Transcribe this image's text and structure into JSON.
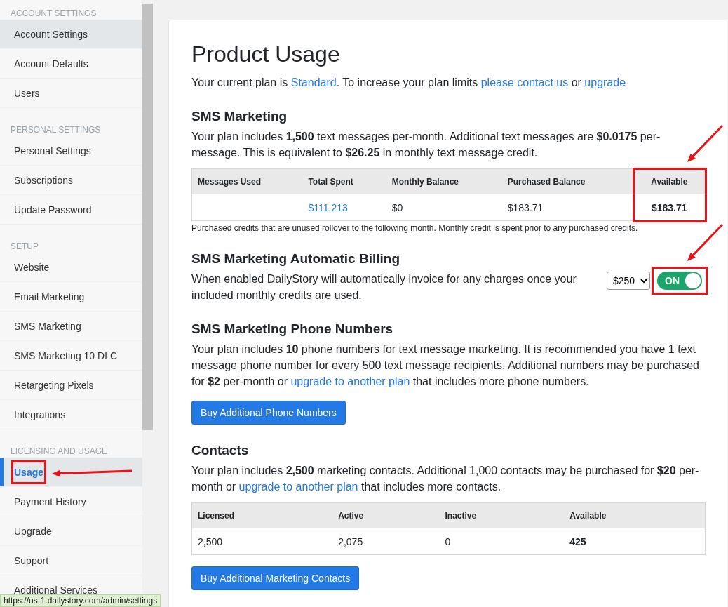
{
  "sidebar": {
    "sections": [
      {
        "heading": "ACCOUNT SETTINGS",
        "items": [
          {
            "label": "Account Settings",
            "selected": false,
            "hovered": true
          },
          {
            "label": "Account Defaults",
            "selected": false,
            "hovered": false
          },
          {
            "label": "Users",
            "selected": false,
            "hovered": false
          }
        ]
      },
      {
        "heading": "PERSONAL SETTINGS",
        "items": [
          {
            "label": "Personal Settings",
            "selected": false,
            "hovered": false
          },
          {
            "label": "Subscriptions",
            "selected": false,
            "hovered": false
          },
          {
            "label": "Update Password",
            "selected": false,
            "hovered": false
          }
        ]
      },
      {
        "heading": "SETUP",
        "items": [
          {
            "label": "Website",
            "selected": false,
            "hovered": false
          },
          {
            "label": "Email Marketing",
            "selected": false,
            "hovered": false
          },
          {
            "label": "SMS Marketing",
            "selected": false,
            "hovered": false
          },
          {
            "label": "SMS Marketing 10 DLC",
            "selected": false,
            "hovered": false
          },
          {
            "label": "Retargeting Pixels",
            "selected": false,
            "hovered": false
          },
          {
            "label": "Integrations",
            "selected": false,
            "hovered": false
          }
        ]
      },
      {
        "heading": "LICENSING AND USAGE",
        "items": [
          {
            "label": "Usage",
            "selected": true,
            "hovered": false,
            "annotated": true
          },
          {
            "label": "Payment History",
            "selected": false,
            "hovered": false
          },
          {
            "label": "Upgrade",
            "selected": false,
            "hovered": false
          },
          {
            "label": "Support",
            "selected": false,
            "hovered": false
          },
          {
            "label": "Additional Services",
            "selected": false,
            "hovered": false
          }
        ]
      }
    ]
  },
  "page": {
    "title": "Product Usage",
    "intro": [
      {
        "text": "Your current plan is "
      },
      {
        "link": "Standard"
      },
      {
        "text": ". To increase your plan limits "
      },
      {
        "link": "please contact us"
      },
      {
        "text": " or "
      },
      {
        "link": "upgrade"
      }
    ],
    "sections": [
      {
        "kind": "table",
        "heading": "SMS Marketing",
        "text": [
          {
            "text": "Your plan includes **1,500** text messages per-month. Additional text messages are **$0.0175** per-message. This is equivalent to **$26.25** in monthly text message credit."
          }
        ],
        "table": {
          "columns": [
            {
              "label": "Messages Used"
            },
            {
              "label": "Total Spent"
            },
            {
              "label": "Monthly Balance"
            },
            {
              "label": "Purchased Balance"
            },
            {
              "label": "Available",
              "annotated": true
            }
          ],
          "rows": [
            [
              {
                "text": ""
              },
              {
                "text": "$111.213",
                "link": true
              },
              {
                "text": "$0"
              },
              {
                "text": "$183.71"
              },
              {
                "text": "$183.71",
                "bold": true
              }
            ]
          ]
        },
        "note": "Purchased credits that are unused rollover to the following month. Monthly credit is spent prior to any purchased credits."
      },
      {
        "kind": "billing",
        "heading": "SMS Marketing Automatic Billing",
        "text": [
          {
            "text": "When enabled DailyStory will automatically invoice for any charges once your included monthly credits are used."
          }
        ],
        "amount": "$250",
        "toggle": {
          "label": "ON",
          "on": true,
          "annotated": true
        }
      },
      {
        "kind": "button",
        "heading": "SMS Marketing Phone Numbers",
        "text": [
          {
            "text": "Your plan includes **10** phone numbers for text message marketing. It is recommended you have 1 text message phone number for every 500 text message recipients. Additional numbers may be purchased for **$2** per-month or "
          },
          {
            "link": "upgrade to another plan"
          },
          {
            "text": " that includes more phone numbers."
          }
        ],
        "button": "Buy Additional Phone Numbers"
      },
      {
        "kind": "table",
        "heading": "Contacts",
        "text": [
          {
            "text": "Your plan includes **2,500** marketing contacts. Additional 1,000 contacts may be purchased for **$20** per-month or "
          },
          {
            "link": "upgrade to another plan"
          },
          {
            "text": " that includes more contacts."
          }
        ],
        "table": {
          "columns": [
            {
              "label": "Licensed"
            },
            {
              "label": "Active"
            },
            {
              "label": "Inactive"
            },
            {
              "label": "Available"
            }
          ],
          "rows": [
            [
              {
                "text": "2,500"
              },
              {
                "text": "2,075"
              },
              {
                "text": "0"
              },
              {
                "text": "425",
                "bold": true
              }
            ]
          ]
        },
        "button": "Buy Additional Marketing Contacts"
      }
    ]
  },
  "status_bar": {
    "url": "https://us-1.dailystory.com/admin/settings"
  }
}
